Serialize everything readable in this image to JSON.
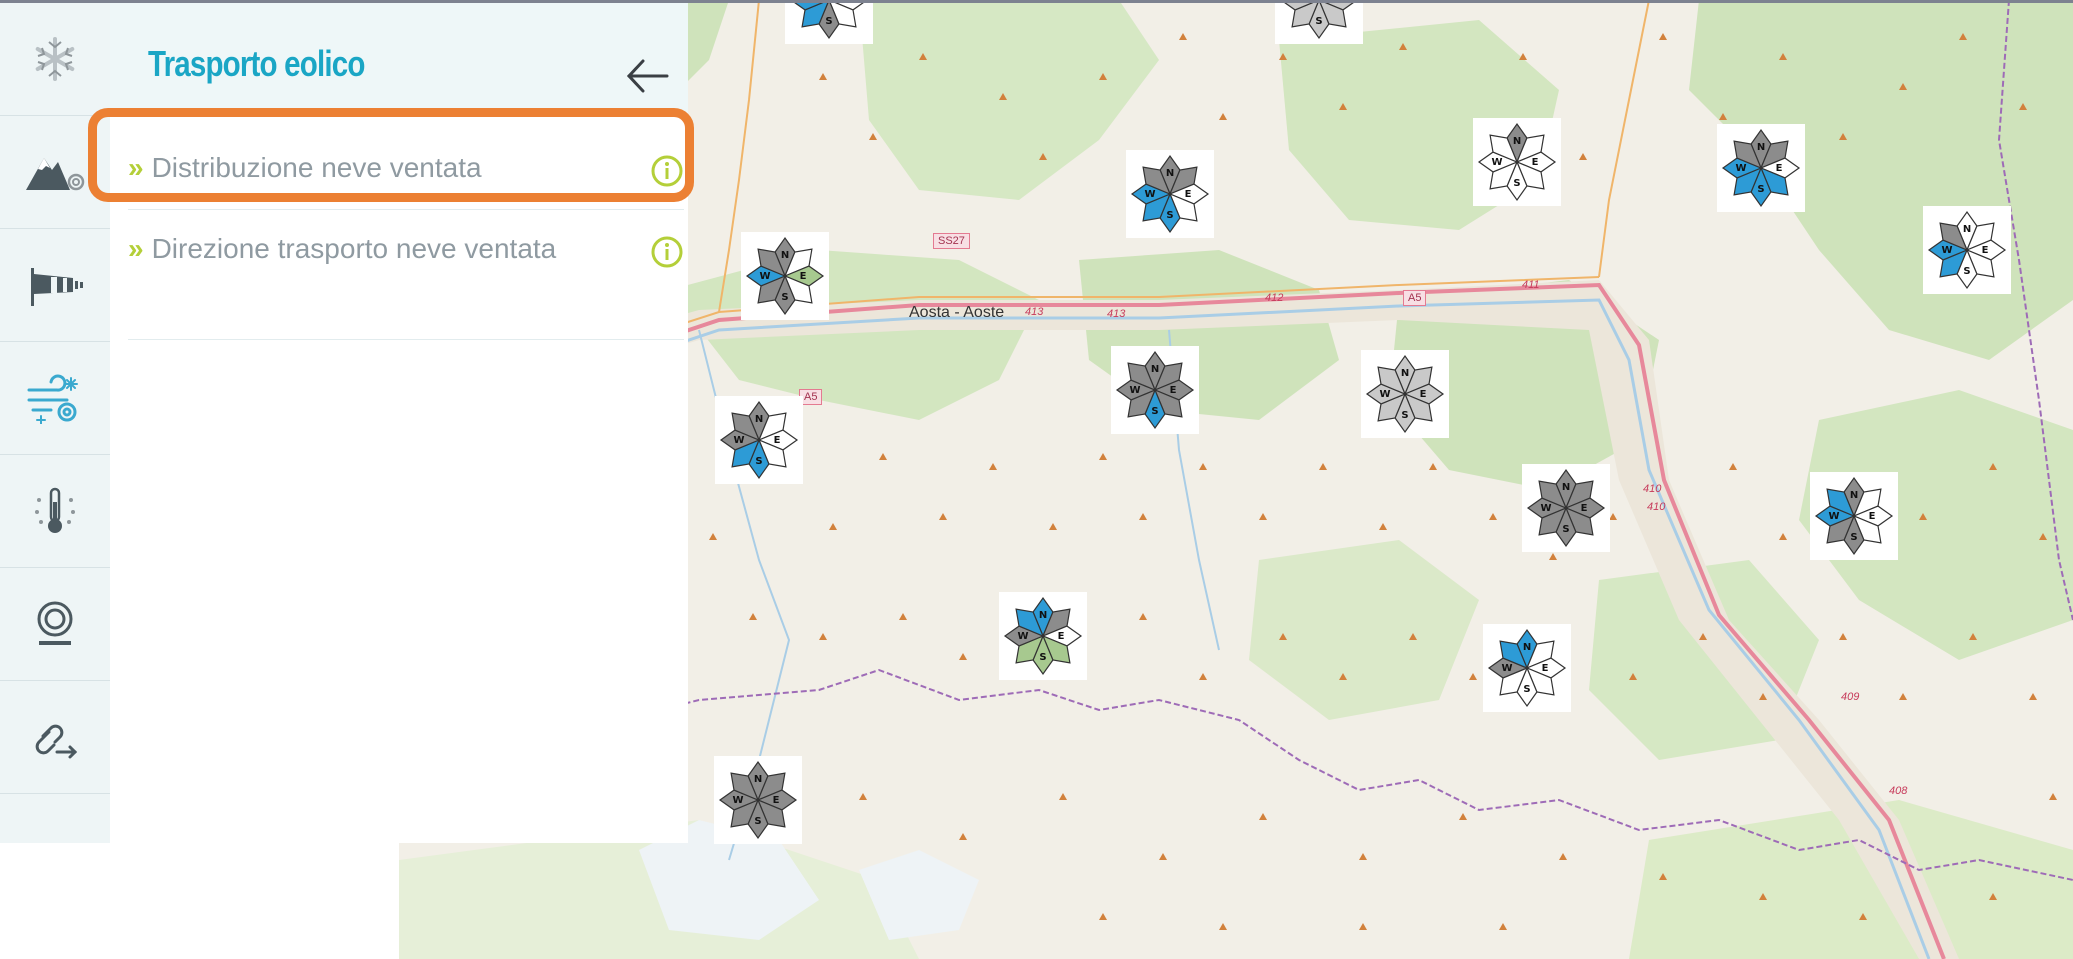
{
  "panel": {
    "title": "Trasporto eolico",
    "items": [
      {
        "label": "Distribuzione neve ventata",
        "selected": true
      },
      {
        "label": "Direzione trasporto neve ventata",
        "selected": false
      }
    ]
  },
  "rail": {
    "icons": [
      "snowflake-icon",
      "mountain-snow-icon",
      "windsock-icon",
      "wind-snow-icon",
      "thermometer-icon",
      "snow-profile-icon",
      "link-icon"
    ]
  },
  "map": {
    "labels": {
      "city": "Aosta - Aoste",
      "road_ss27": "SS27",
      "road_413a": "413",
      "road_413b": "413",
      "road_412": "412",
      "road_a5_east": "A5",
      "road_a5_west": "A5",
      "road_411": "411",
      "road_410a": "410",
      "road_410b": "410",
      "road_409": "409",
      "road_408": "408"
    },
    "compass_letters": {
      "n": "N",
      "e": "E",
      "s": "S",
      "w": "W"
    }
  },
  "colors": {
    "accent": "#1aa6c5",
    "chevron": "#b4cf39",
    "highlight": "#ec8033",
    "blue_sector": "#2d9bd6",
    "gray_sector": "#8c8c8c",
    "green_sector": "#a7c98f"
  }
}
